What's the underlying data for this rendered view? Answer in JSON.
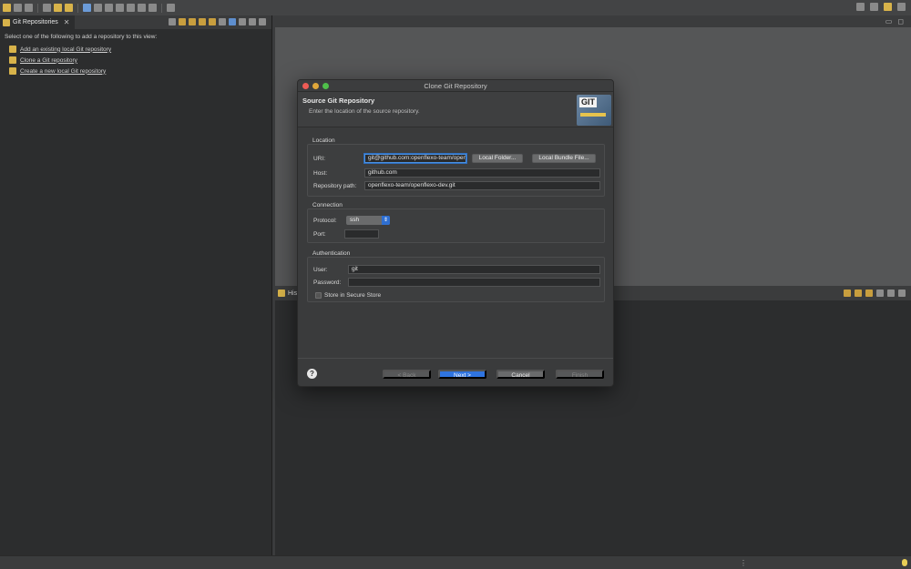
{
  "left_view": {
    "tab_label": "Git Repositories",
    "intro": "Select one of the following to add a repository to this view:",
    "links": [
      "Add an existing local Git repository",
      "Clone a Git repository",
      "Create a new local Git repository"
    ]
  },
  "bottom_view": {
    "tab_label": "His"
  },
  "dialog": {
    "title": "Clone Git Repository",
    "header_title": "Source Git Repository",
    "header_desc": "Enter the location of the source repository.",
    "logo_text": "GIT",
    "location": {
      "title": "Location",
      "uri_label": "URI:",
      "uri_value": "git@github.com:openflexo-team/openflexo-dev.git",
      "local_folder_button": "Local Folder...",
      "local_bundle_button": "Local Bundle File...",
      "host_label": "Host:",
      "host_value": "github.com",
      "repo_path_label": "Repository path:",
      "repo_path_value": "openflexo-team/openflexo-dev.git"
    },
    "connection": {
      "title": "Connection",
      "protocol_label": "Protocol:",
      "protocol_value": "ssh",
      "port_label": "Port:",
      "port_value": ""
    },
    "authentication": {
      "title": "Authentication",
      "user_label": "User:",
      "user_value": "git",
      "password_label": "Password:",
      "password_value": "",
      "store_label": "Store in Secure Store"
    },
    "footer": {
      "help_symbol": "?",
      "back": "< Back",
      "next": "Next >",
      "cancel": "Cancel",
      "finish": "Finish"
    }
  }
}
